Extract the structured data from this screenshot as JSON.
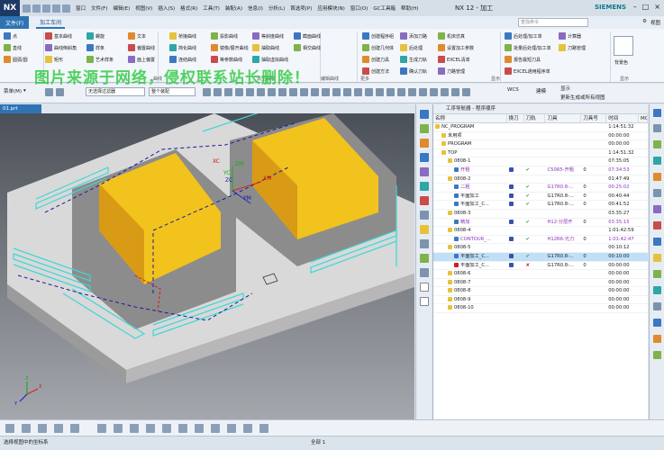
{
  "title_bar": {
    "logo": "NX",
    "menus": [
      "窗口",
      "文件(F)",
      "编辑(E)",
      "视图(V)",
      "插入(S)",
      "格式(R)",
      "工具(T)",
      "装配(A)",
      "信息(I)",
      "分析(L)",
      "首选项(P)",
      "应用模块(N)",
      "窗口(O)",
      "GC工具箱",
      "帮助(H)"
    ],
    "app_title": "NX 12 - 加工",
    "brand": "SIEMENS"
  },
  "ribbon_tabs": {
    "file": "文件(F)",
    "active": "加工车间"
  },
  "search": {
    "placeholder": "查找命令"
  },
  "ribbon_right": {
    "icon_label": "⚙",
    "tab": "视图"
  },
  "ribbon": {
    "sketch": [
      "点",
      "直线",
      "圆弧/圆",
      "基本曲线",
      "曲线倒斜角",
      "矩形",
      "螺旋",
      "样条",
      "艺术样条",
      "文本",
      "偏置曲线",
      "面上偏置",
      "桥接曲线",
      "简化曲线",
      "连结曲线",
      "投影曲线",
      "镜像/展开曲线",
      "等参数曲线",
      "等斜度曲线",
      "抽取曲线",
      "抽取虚拟曲线",
      "截面曲线",
      "相交曲线"
    ],
    "insert": [
      "创建程序组",
      "创建几何体",
      "创建刀具",
      "创建方法",
      "添加刀路",
      "后处理",
      "生成刀轨",
      "确认刀轨",
      "机床仿真",
      "设置加工参数",
      "EXCEL清单",
      "刀路管理"
    ],
    "right": [
      "后处理/加工单",
      "批量后处理/加工单",
      "报告最短刀具",
      "EXCEL通用程序单",
      "计算器",
      "刀路管理",
      "背景色"
    ],
    "group_labels": [
      "曲线",
      "派生曲线",
      "编辑曲线",
      "更多",
      "显示",
      "显示"
    ]
  },
  "toolbar": {
    "menu_label": "菜单(M)",
    "filter": "无选择过滤器",
    "assembly": "整个装配",
    "wcs": "WCS",
    "create": "建模",
    "display": "显示",
    "check": "查询",
    "update": "更新生成或所有视图"
  },
  "watermark": "图片来源于网络，侵权联系站长删除！",
  "viewport": {
    "tab": "01.prt",
    "axes": {
      "zm": "ZM",
      "xm": "XM",
      "ym": "YM",
      "zc": "ZC",
      "yc": "YC",
      "xc": "XC"
    },
    "triad": {
      "x": "X",
      "y": "Y",
      "z": "Z"
    }
  },
  "navigator": {
    "title": "工序导航器 - 程序顺序",
    "columns": [
      "名称",
      "换刀",
      "刀轨",
      "刀具",
      "刀具号",
      "时间",
      "MC"
    ],
    "rows": [
      {
        "name": "NC_PROGRAM",
        "time": "1:14:51:32",
        "indent": 0
      },
      {
        "name": "未用项",
        "time": "00:00:00",
        "indent": 1
      },
      {
        "name": "PROGRAM",
        "time": "00:00:00",
        "indent": 1
      },
      {
        "name": "TOP",
        "time": "1:14:51:32",
        "indent": 1
      },
      {
        "name": "0808-1",
        "time": "07:35:05",
        "indent": 2
      },
      {
        "name": "开粗",
        "path": "✔",
        "tool": "C50R5-开粗",
        "tn": "0",
        "time": "07:34:53",
        "indent": 3,
        "purple": true
      },
      {
        "name": "0808-2",
        "time": "01:47:49",
        "indent": 2
      },
      {
        "name": "二粗",
        "path": "✔",
        "tool": "G17R0.8-...",
        "tn": "0",
        "time": "00:25:02",
        "indent": 3,
        "purple": true
      },
      {
        "name": "平面加工",
        "path": "✔",
        "tool": "G17R0.8-...",
        "tn": "0",
        "time": "00:40:44",
        "indent": 3
      },
      {
        "name": "平面加工_C...",
        "path": "✔",
        "tool": "G17R0.8-...",
        "tn": "0",
        "time": "00:41:52",
        "indent": 3
      },
      {
        "name": "0808-3",
        "time": "03:35:27",
        "indent": 2
      },
      {
        "name": "精加",
        "path": "✔",
        "tool": "H12-分层开",
        "tn": "0",
        "time": "03:35:15",
        "indent": 3,
        "purple": true
      },
      {
        "name": "0808-4",
        "time": "1:01:42:59",
        "indent": 2
      },
      {
        "name": "CONTOUR_...",
        "path": "✔",
        "tool": "H12R6-光刀",
        "tn": "0",
        "time": "1:01:42:47",
        "indent": 3,
        "purple": true
      },
      {
        "name": "0808-5",
        "time": "00:10:12",
        "indent": 2
      },
      {
        "name": "平面加工_C...",
        "path": "✔",
        "tool": "G17R0.8-...",
        "tn": "0",
        "time": "00:10:00",
        "indent": 3,
        "hl": true
      },
      {
        "name": "平面加工_C...",
        "path": "✘",
        "tool": "G17R0.8-...",
        "tn": "0",
        "time": "00:00:00",
        "indent": 3,
        "bad": true
      },
      {
        "name": "0808-6",
        "time": "00:00:00",
        "indent": 2
      },
      {
        "name": "0808-7",
        "time": "00:00:00",
        "indent": 2
      },
      {
        "name": "0808-8",
        "time": "00:00:00",
        "indent": 2
      },
      {
        "name": "0808-9",
        "time": "00:00:00",
        "indent": 2
      },
      {
        "name": "0808-10",
        "time": "00:00:00",
        "indent": 2
      }
    ]
  },
  "status": {
    "left": "选择视图中的坐标系",
    "center": "全部 1"
  }
}
